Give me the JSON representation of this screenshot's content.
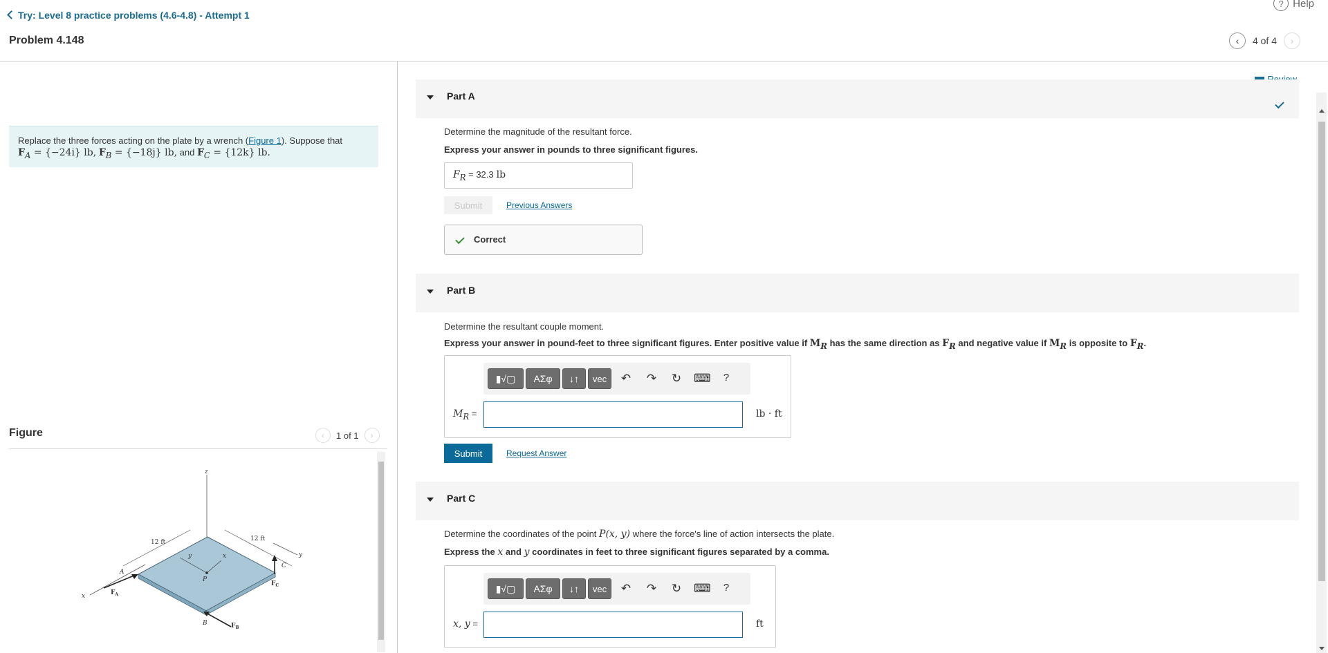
{
  "header": {
    "back_link": "Try: Level 8 practice problems (4.6-4.8) - Attempt 1",
    "problem_title": "Problem 4.148",
    "help": "Help",
    "pager": "4 of 4"
  },
  "statement": {
    "text_before": "Replace the three forces acting on the plate by a wrench (",
    "figure_link": "Figure 1",
    "text_after": "). Suppose that",
    "fa": "F",
    "fa_sub": "A",
    "fa_val": " = {−24i} lb,",
    "fb": "F",
    "fb_sub": "B",
    "fb_val": " = {−18j} lb,",
    "and": " and ",
    "fc": "F",
    "fc_sub": "C",
    "fc_val": " = {12k} lb."
  },
  "figure": {
    "heading": "Figure",
    "pager": "1 of 1",
    "labels": {
      "z": "z",
      "x": "x",
      "y": "y",
      "y2": "y",
      "x2": "x",
      "d1": "12 ft",
      "d2": "12 ft",
      "A": "A",
      "B": "B",
      "C": "C",
      "P": "P",
      "FA": "F",
      "FA_sub": "A",
      "FB": "F",
      "FB_sub": "B",
      "FC": "F",
      "FC_sub": "C"
    }
  },
  "review": "Review",
  "part_a": {
    "label": "Part A",
    "question": "Determine the magnitude of the resultant force.",
    "instruction": "Express your answer in pounds to three significant figures.",
    "answer_var": "F",
    "answer_sub": "R",
    "answer_eq": " = ",
    "answer_value": "32.3",
    "answer_unit": "lb",
    "submit": "Submit",
    "previous_answers": "Previous Answers",
    "status": "Correct"
  },
  "part_b": {
    "label": "Part B",
    "question": "Determine the resultant couple moment.",
    "instruction_1": "Express your answer in pound-feet to three significant figures. Enter positive value if ",
    "m1": "M",
    "m1_sub": "R",
    "instruction_2": " has the same direction as ",
    "f1": "F",
    "f1_sub": "R",
    "instruction_3": " and negative value if ",
    "m2": "M",
    "m2_sub": "R",
    "instruction_4": " is opposite to ",
    "f2": "F",
    "f2_sub": "R",
    "instruction_5": ".",
    "input_label": "M",
    "input_sub": "R",
    "input_eq": " =",
    "input_value": "",
    "unit": "lb · ft",
    "submit": "Submit",
    "request_answer": "Request Answer"
  },
  "part_c": {
    "label": "Part C",
    "question_1": "Determine the coordinates of the point ",
    "point": "P(x, y)",
    "question_2": " where the force's line of action intersects the plate.",
    "instruction_1": "Express the ",
    "x": "x",
    "instruction_2": " and ",
    "y": "y",
    "instruction_3": " coordinates in feet to three significant figures separated by a comma.",
    "input_label": "x, y",
    "input_eq": " =",
    "input_value": "",
    "unit": "ft"
  },
  "toolbar": {
    "templates": "▮√▢",
    "greek": "ΑΣφ",
    "arrows": "↓↑",
    "vec": "vec",
    "undo": "↶",
    "redo": "↷",
    "reset": "↻",
    "keyboard": "⌨",
    "help": "?"
  },
  "colors": {
    "accent": "#0b6a99",
    "correct": "#3b8d35",
    "statement_bg": "#e6f4f5",
    "plate": "#a9c7d6"
  }
}
